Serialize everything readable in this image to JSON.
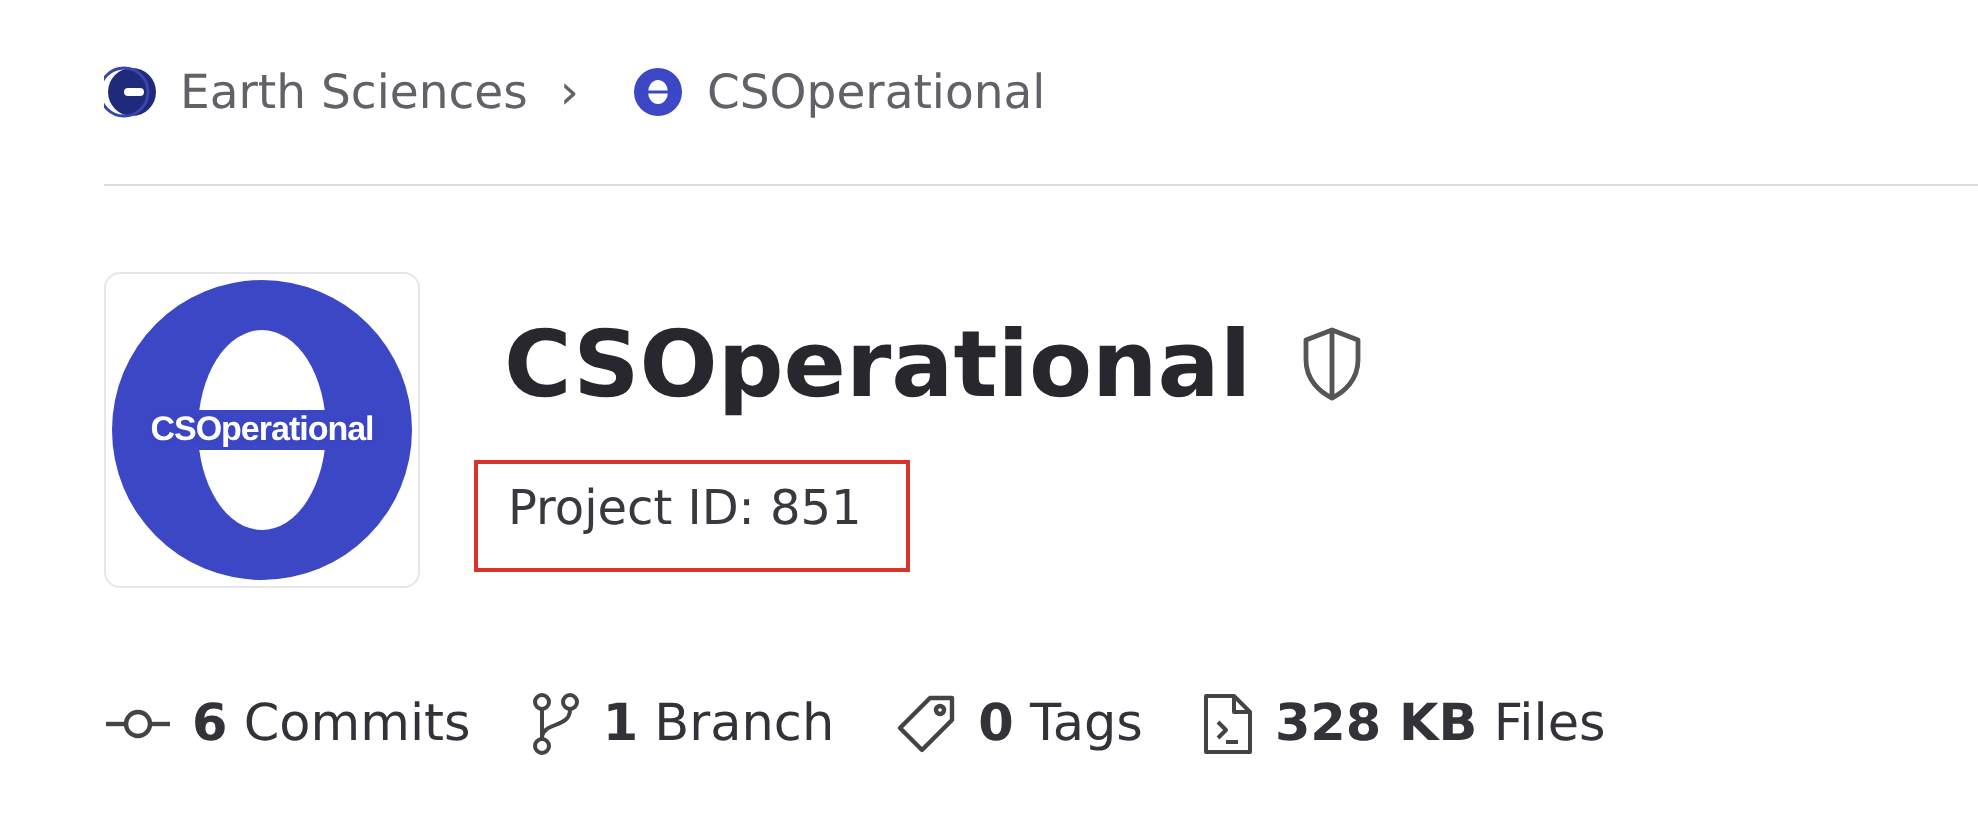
{
  "breadcrumb": [
    {
      "label": "Earth Sciences",
      "kind": "group"
    },
    {
      "label": "CSOperational",
      "kind": "project"
    }
  ],
  "breadcrumb_separator": "›",
  "project": {
    "logo_text": "CSOperational",
    "title": "CSOperational",
    "project_id": "Project ID: 851",
    "highlighted": true
  },
  "stats": [
    {
      "kind": "commits",
      "text": "**6** Commits"
    },
    {
      "kind": "branch",
      "text": "**1** Branch"
    },
    {
      "kind": "tags",
      "text": "**0** Tags"
    },
    {
      "kind": "files",
      "text": "**328 KB** Files"
    }
  ]
}
